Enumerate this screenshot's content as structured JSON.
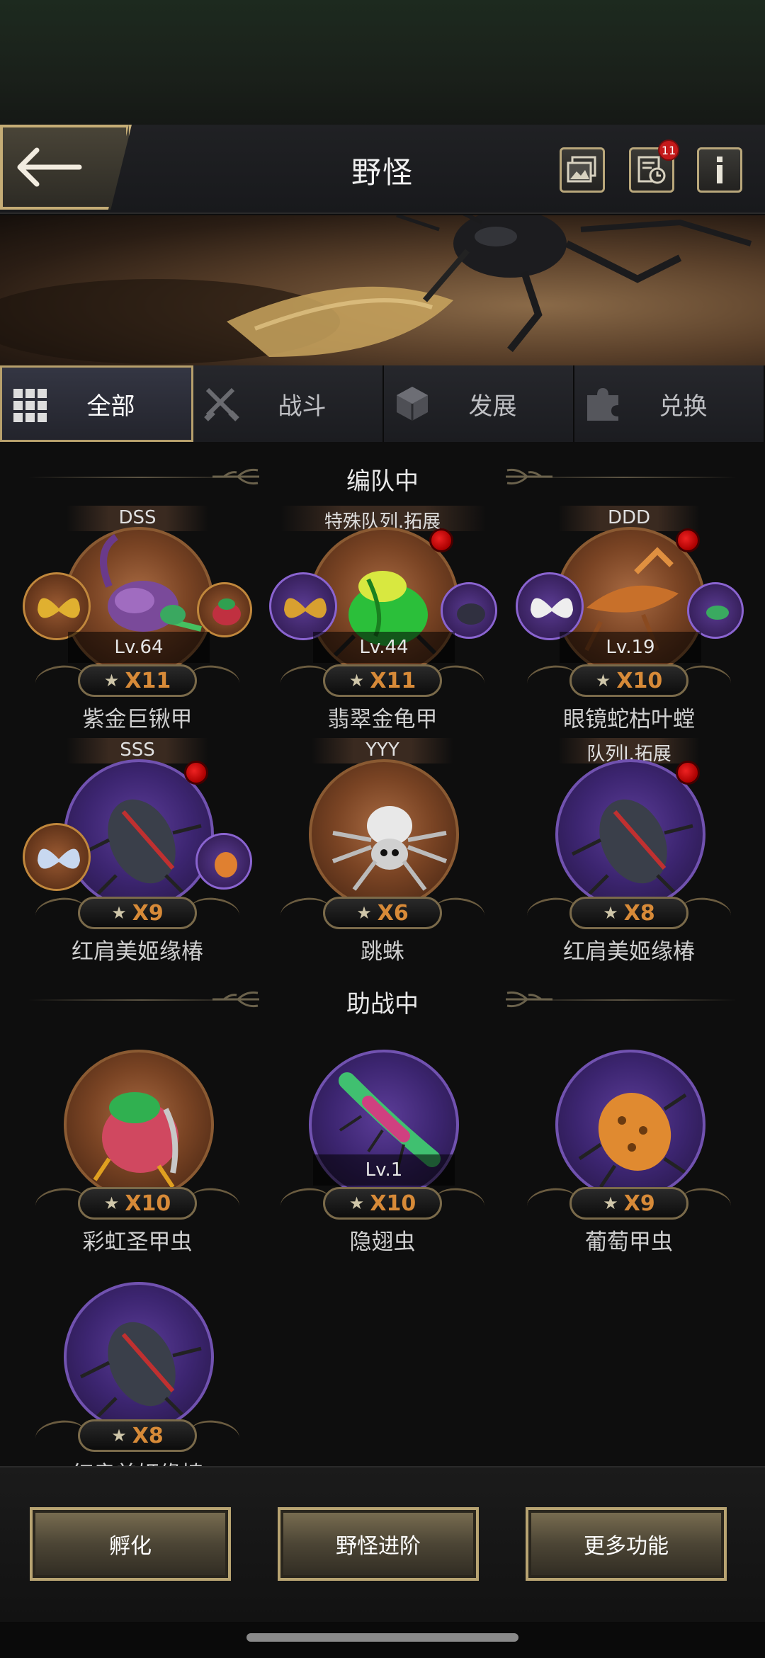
{
  "header": {
    "title": "野怪",
    "notification_count": "11",
    "icons": [
      "gallery-icon",
      "history-icon",
      "info-icon"
    ]
  },
  "tabs": [
    {
      "label": "全部",
      "icon": "grid-icon",
      "active": true
    },
    {
      "label": "战斗",
      "icon": "crossed-swords-icon",
      "active": false
    },
    {
      "label": "发展",
      "icon": "cube-icon",
      "active": false
    },
    {
      "label": "兑换",
      "icon": "puzzle-icon",
      "active": false
    }
  ],
  "sections": {
    "formation_title": "编队中",
    "support_title": "助战中"
  },
  "formation": [
    {
      "tag": "DSS",
      "level": "Lv.64",
      "stars": "X11",
      "name": "紫金巨锹甲",
      "disc": "bronze",
      "red_dot": false
    },
    {
      "tag": "特殊队列.拓展",
      "level": "Lv.44",
      "stars": "X11",
      "name": "翡翠金龟甲",
      "disc": "bronze",
      "red_dot": true
    },
    {
      "tag": "DDD",
      "level": "Lv.19",
      "stars": "X10",
      "name": "眼镜蛇枯叶螳",
      "disc": "bronze",
      "red_dot": true
    },
    {
      "tag": "SSS",
      "level": "",
      "stars": "X9",
      "name": "红肩美姬缘椿",
      "disc": "purple",
      "red_dot": true
    },
    {
      "tag": "YYY",
      "level": "",
      "stars": "X6",
      "name": "跳蛛",
      "disc": "bronze",
      "red_dot": false
    },
    {
      "tag": "队列l.拓展",
      "level": "",
      "stars": "X8",
      "name": "红肩美姬缘椿",
      "disc": "purple",
      "red_dot": true
    }
  ],
  "support": [
    {
      "level": "",
      "stars": "X10",
      "name": "彩虹圣甲虫",
      "disc": "bronze"
    },
    {
      "level": "Lv.1",
      "stars": "X10",
      "name": "隐翅虫",
      "disc": "purple"
    },
    {
      "level": "",
      "stars": "X9",
      "name": "葡萄甲虫",
      "disc": "purple"
    },
    {
      "level": "",
      "stars": "X8",
      "name": "红肩美姬缘椿",
      "disc": "purple"
    }
  ],
  "star_glyph": "★",
  "bottom": {
    "hatch": "孵化",
    "advance": "野怪进阶",
    "more": "更多功能"
  }
}
